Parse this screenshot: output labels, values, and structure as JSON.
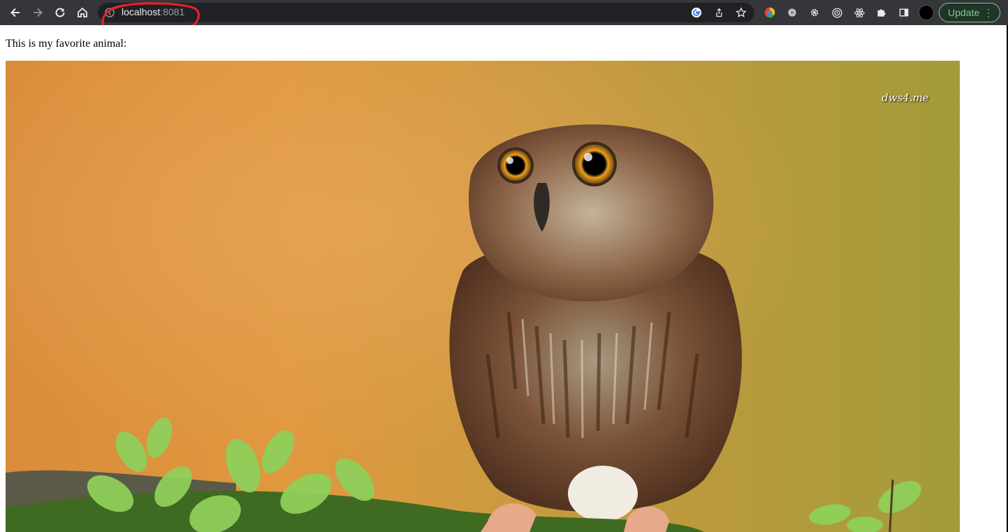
{
  "browser": {
    "url_host": "localhost",
    "url_port": ":8081",
    "update_label": "Update",
    "icons": {
      "back": "arrow-left-icon",
      "forward": "arrow-right-icon",
      "reload": "reload-icon",
      "home": "home-icon",
      "google_lens": "google-icon",
      "share": "share-icon",
      "bookmark": "star-icon",
      "extensions": [
        "color-picker-icon",
        "ext-gray-icon",
        "gear-icon",
        "target-icon",
        "react-icon",
        "puzzle-icon",
        "side-panel-icon"
      ]
    },
    "colors": {
      "toolbar": "#35363a",
      "omnibox": "#202124",
      "update_accent": "#81c995",
      "annotation": "#e8212b"
    }
  },
  "page": {
    "text": "This is my favorite animal:",
    "image_subject": "owl-photo",
    "watermark": "dws4.me"
  }
}
